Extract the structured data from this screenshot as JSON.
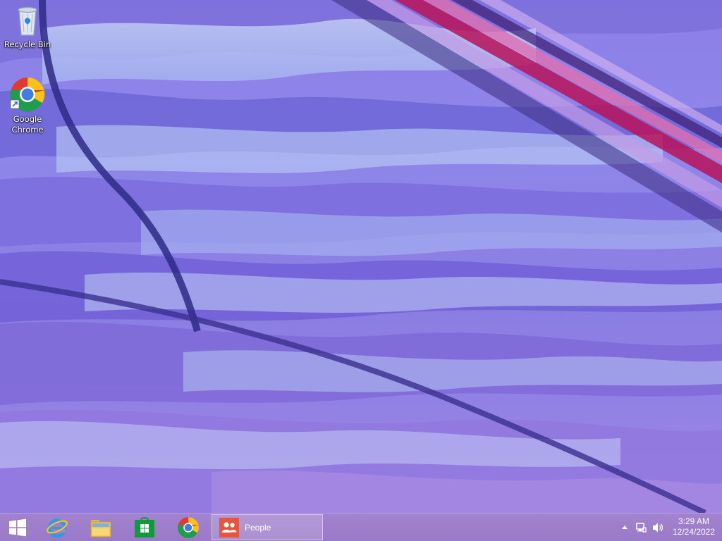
{
  "desktop": {
    "icons": [
      {
        "label": "Recycle Bin",
        "icon": "recycle-bin-icon"
      },
      {
        "label": "Google Chrome",
        "icon": "chrome-icon"
      }
    ]
  },
  "taskbar": {
    "pinned": [
      {
        "name": "Internet Explorer",
        "icon": "internet-explorer-icon"
      },
      {
        "name": "File Explorer",
        "icon": "file-explorer-icon"
      },
      {
        "name": "Store",
        "icon": "store-icon"
      },
      {
        "name": "Google Chrome",
        "icon": "chrome-icon"
      }
    ],
    "active_window": {
      "label": "People",
      "icon": "people-icon",
      "color": "#e7553a"
    }
  },
  "tray": {
    "icons": [
      "chevron-up-icon",
      "network-icon",
      "volume-icon"
    ],
    "clock": {
      "time": "3:29 AM",
      "date": "12/24/2022"
    }
  },
  "colors": {
    "taskbar": "#9a79c8",
    "wallpaper_base": "#8c7fe6",
    "stripe_accent": "#b8135a"
  }
}
